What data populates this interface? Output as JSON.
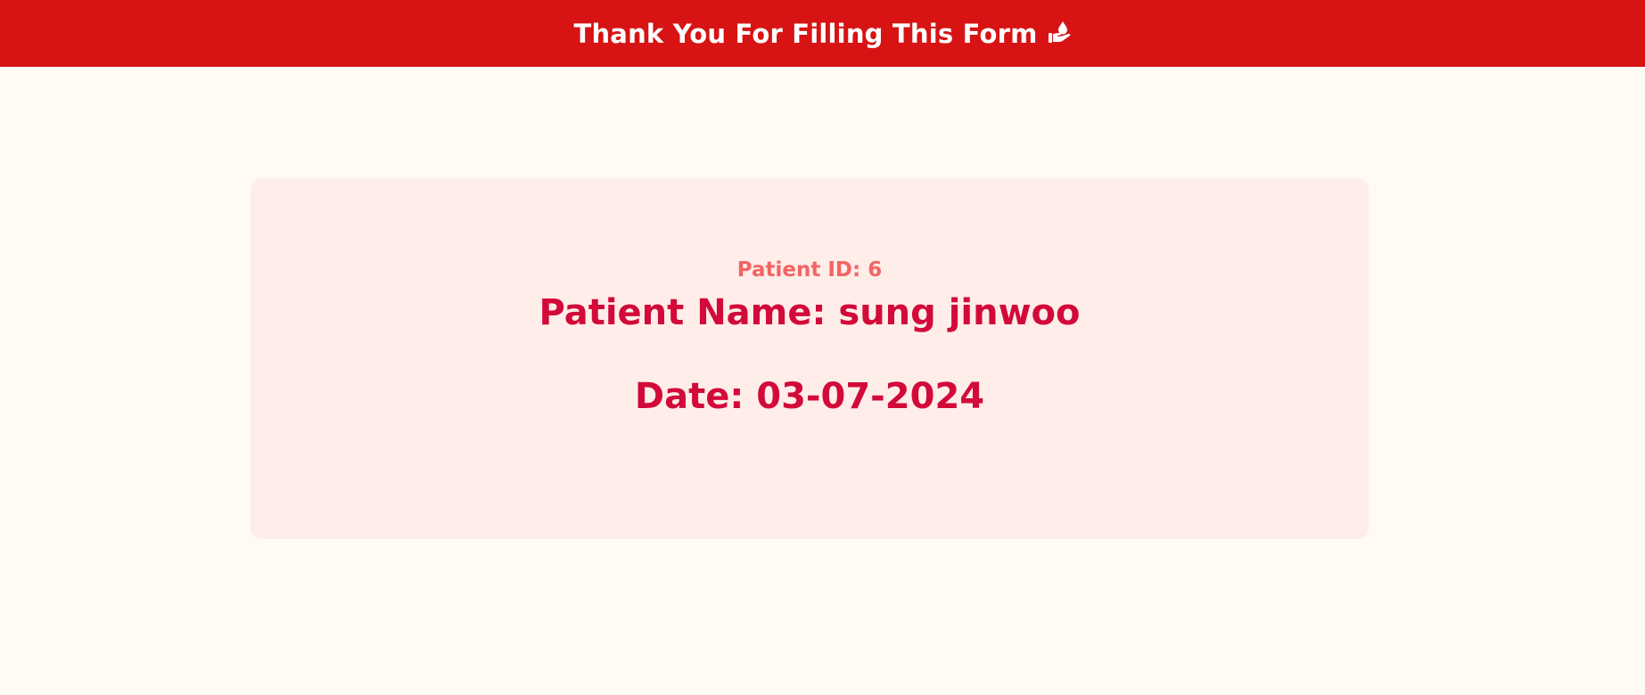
{
  "header": {
    "title": "Thank You For Filling This Form",
    "icon": "hand-holding-drop-icon",
    "background": "#d71313"
  },
  "card": {
    "patient_id": "Patient ID: 6",
    "patient_name": "Patient Name: sung jinwoo",
    "date": "Date: 03-07-2024",
    "background": "#feede8",
    "accent": "#d20a3a"
  }
}
